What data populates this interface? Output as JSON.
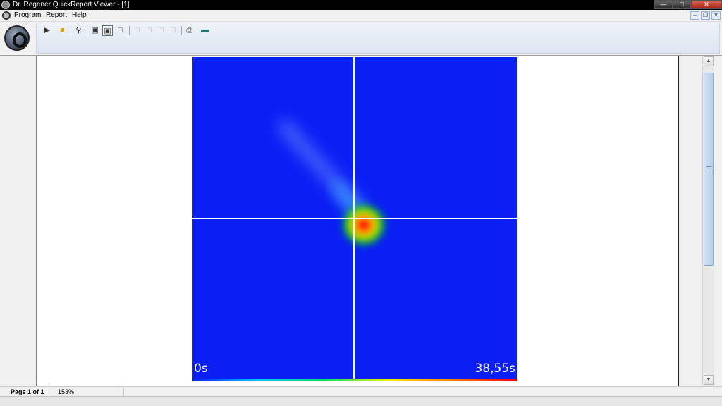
{
  "window": {
    "title": "Dr. Regener QuickReport Viewer - [1]",
    "controls": [
      "minimize-icon",
      "maximize-icon",
      "close-icon"
    ]
  },
  "menu": {
    "items": [
      {
        "label": "Program"
      },
      {
        "label": "Report"
      },
      {
        "label": "Help"
      }
    ],
    "mdi_controls": [
      "mdi-minimize-icon",
      "mdi-restore-icon",
      "mdi-close-icon"
    ]
  },
  "toolbar": {
    "tools": [
      {
        "icon": "exit-icon",
        "enabled": true
      },
      {
        "icon": "open-folder-icon",
        "enabled": true
      },
      {
        "icon": "zoom-page-icon",
        "enabled": true
      },
      {
        "icon": "single-page-icon",
        "enabled": true
      },
      {
        "icon": "page-width-icon",
        "enabled": true,
        "pressed": true
      },
      {
        "icon": "full-page-icon",
        "enabled": true
      },
      {
        "icon": "first-page-icon",
        "enabled": false
      },
      {
        "icon": "previous-page-icon",
        "enabled": false
      },
      {
        "icon": "next-page-icon",
        "enabled": false
      },
      {
        "icon": "last-page-icon",
        "enabled": false
      },
      {
        "icon": "print-icon",
        "enabled": true
      },
      {
        "icon": "export-icon",
        "enabled": true
      }
    ]
  },
  "report": {
    "heatmap": {
      "start_label": "0s",
      "end_label": "38,55s",
      "colors": {
        "background": "#0a1ff4",
        "core": "#ff0000",
        "ring_inner": "#ffd000",
        "ring_outer": "#00e000",
        "crosshair": "#ffffff"
      }
    }
  },
  "status": {
    "page": "Page 1 of 1",
    "zoom": "153%"
  }
}
